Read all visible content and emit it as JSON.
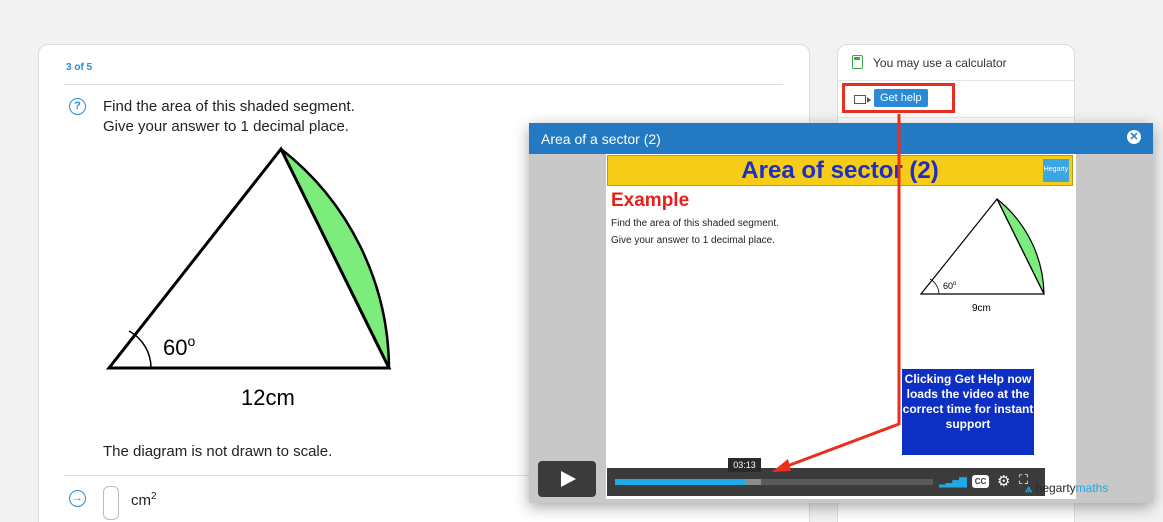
{
  "question": {
    "counter": "3 of 5",
    "text_line1": "Find the area of this shaded segment.",
    "text_line2": "Give your answer to 1 decimal place.",
    "diagram": {
      "angle_label": "60",
      "angle_unit": "o",
      "side_label": "12cm"
    },
    "note": "The diagram is not drawn to scale.",
    "answer": {
      "value": "",
      "unit": "cm",
      "unit_power": "2"
    }
  },
  "sidebar": {
    "calculator_text": "You may use a calculator",
    "help_button": "Get help"
  },
  "modal": {
    "title": "Area of a sector (2)",
    "slide": {
      "banner": "Area of sector (2)",
      "logo_text": "Hegarty",
      "example_heading": "Example",
      "line1": "Find the area of this shaded segment.",
      "line2": "Give your answer to 1 decimal place.",
      "angle_label": "60",
      "angle_unit": "o",
      "side_label": "9cm",
      "callout": "Clicking Get Help now loads the video at the correct time for instant support"
    },
    "player": {
      "time": "03:13",
      "progress_fraction": 0.41,
      "buffered_fraction": 0.46,
      "cc_label": "CC",
      "brand_prefix": "hegarty",
      "brand_suffix": "maths"
    }
  },
  "colors": {
    "accent": "#2a8ad8",
    "segment_fill": "#7ced7c",
    "highlight": "#e8301d",
    "banner": "#f6cc16"
  },
  "icons": [
    "question-icon",
    "answer-arrow-icon",
    "calculator-icon",
    "video-icon",
    "close-icon",
    "play-icon",
    "volume-icon",
    "cc-icon",
    "gear-icon",
    "fullscreen-icon"
  ]
}
